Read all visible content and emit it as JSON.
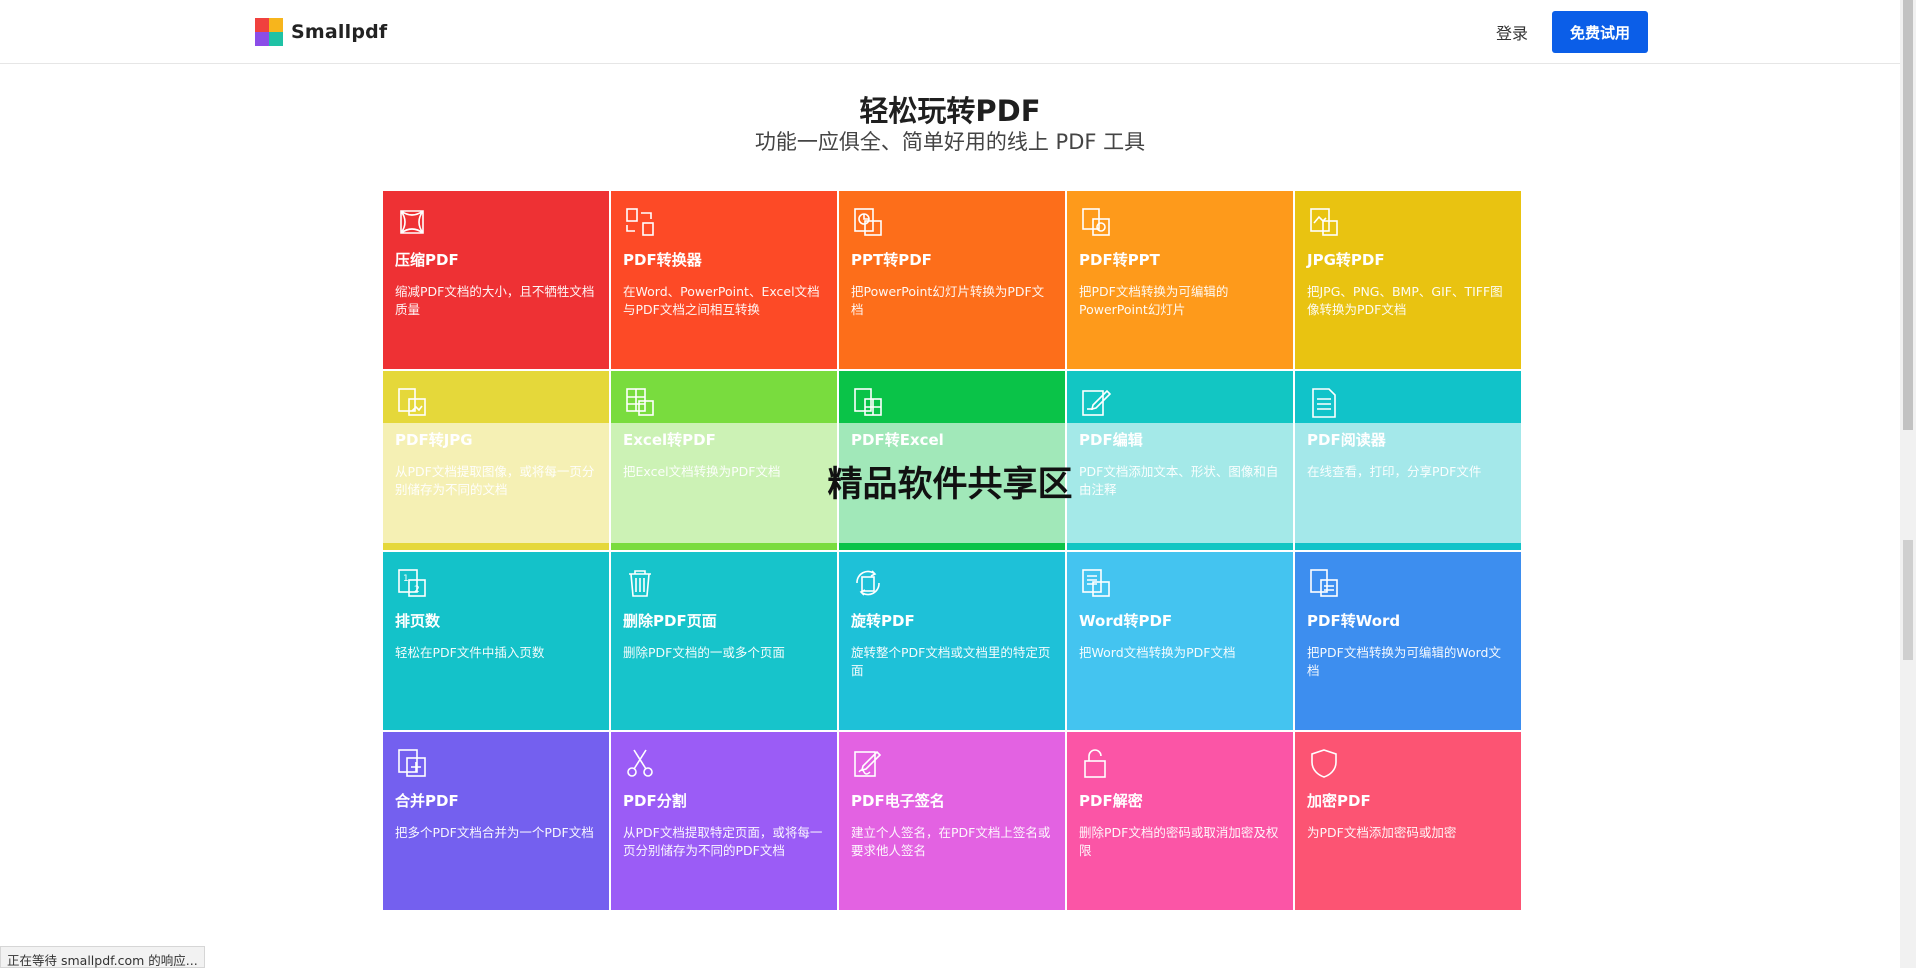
{
  "header": {
    "logo_text": "Smallpdf",
    "login_label": "登录",
    "trial_label": "免费试用"
  },
  "hero": {
    "title": "轻松玩转PDF",
    "subtitle": "功能一应俱全、简单好用的线上 PDF 工具"
  },
  "tools": [
    {
      "title": "压缩PDF",
      "desc": "缩减PDF文档的大小，且不牺牲文档质量",
      "color": "#ee3134",
      "icon": "compress-icon"
    },
    {
      "title": "PDF转换器",
      "desc": "在Word、PowerPoint、Excel文档与PDF文档之间相互转换",
      "color": "#fd4a26",
      "icon": "convert-icon"
    },
    {
      "title": "PPT转PDF",
      "desc": "把PowerPoint幻灯片转换为PDF文档",
      "color": "#fd6e1a",
      "icon": "ppt-icon"
    },
    {
      "title": "PDF转PPT",
      "desc": "把PDF文档转换为可编辑的PowerPoint幻灯片",
      "color": "#fe9a1b",
      "icon": "pdf-to-ppt-icon"
    },
    {
      "title": "JPG转PDF",
      "desc": "把JPG、PNG、BMP、GIF、TIFF图像转换为PDF文档",
      "color": "#e9c311",
      "icon": "jpg-icon"
    },
    {
      "title": "PDF转JPG",
      "desc": "从PDF文档提取图像，或将每一页分别储存为不同的文档",
      "color": "#e5d83a",
      "icon": "pdf-to-jpg-icon"
    },
    {
      "title": "Excel转PDF",
      "desc": "把Excel文档转换为PDF文档",
      "color": "#79dc3e",
      "icon": "excel-icon"
    },
    {
      "title": "PDF转Excel",
      "desc": "",
      "color": "#0ac348",
      "icon": "pdf-to-excel-icon"
    },
    {
      "title": "PDF编辑",
      "desc": "PDF文档添加文本、形状、图像和自由注释",
      "color": "#12c6c3",
      "icon": "edit-icon"
    },
    {
      "title": "PDF阅读器",
      "desc": "在线查看，打印，分享PDF文件",
      "color": "#11c3c9",
      "icon": "reader-icon"
    },
    {
      "title": "排页数",
      "desc": "轻松在PDF文件中插入页数",
      "color": "#14c2c9",
      "icon": "page-number-icon"
    },
    {
      "title": "删除PDF页面",
      "desc": "删除PDF文档的一或多个页面",
      "color": "#17c4cb",
      "icon": "trash-icon"
    },
    {
      "title": "旋转PDF",
      "desc": "旋转整个PDF文档或文档里的特定页面",
      "color": "#1ec1d8",
      "icon": "rotate-icon"
    },
    {
      "title": "Word转PDF",
      "desc": "把Word文档转换为PDF文档",
      "color": "#44c4f0",
      "icon": "word-icon"
    },
    {
      "title": "PDF转Word",
      "desc": "把PDF文档转换为可编辑的Word文档",
      "color": "#3d8eef",
      "icon": "pdf-to-word-icon"
    },
    {
      "title": "合并PDF",
      "desc": "把多个PDF文档合并为一个PDF文档",
      "color": "#7460ef",
      "icon": "merge-icon"
    },
    {
      "title": "PDF分割",
      "desc": "从PDF文档提取特定页面，或将每一页分别储存为不同的PDF文档",
      "color": "#9b5cf6",
      "icon": "scissors-icon"
    },
    {
      "title": "PDF电子签名",
      "desc": "建立个人签名，在PDF文档上签名或要求他人签名",
      "color": "#e362e2",
      "icon": "sign-icon"
    },
    {
      "title": "PDF解密",
      "desc": "删除PDF文档的密码或取消加密及权限",
      "color": "#fb55a6",
      "icon": "unlock-icon"
    },
    {
      "title": "加密PDF",
      "desc": "为PDF文档添加密码或加密",
      "color": "#fc5473",
      "icon": "shield-icon"
    }
  ],
  "watermark": "精品软件共享区",
  "status_text": "正在等待 smallpdf.com 的响应..."
}
